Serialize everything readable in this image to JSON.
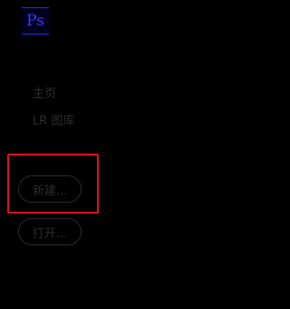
{
  "logo": {
    "text": "Ps"
  },
  "nav": {
    "items": [
      {
        "label": "主页"
      },
      {
        "label": "LR 图库"
      }
    ]
  },
  "actions": {
    "new_label": "新建...",
    "open_label": "打开..."
  },
  "colors": {
    "background": "#000000",
    "logo_accent": "#3a3aff",
    "highlight_border": "#d7141e",
    "text_dim": "#2b2b2b"
  }
}
